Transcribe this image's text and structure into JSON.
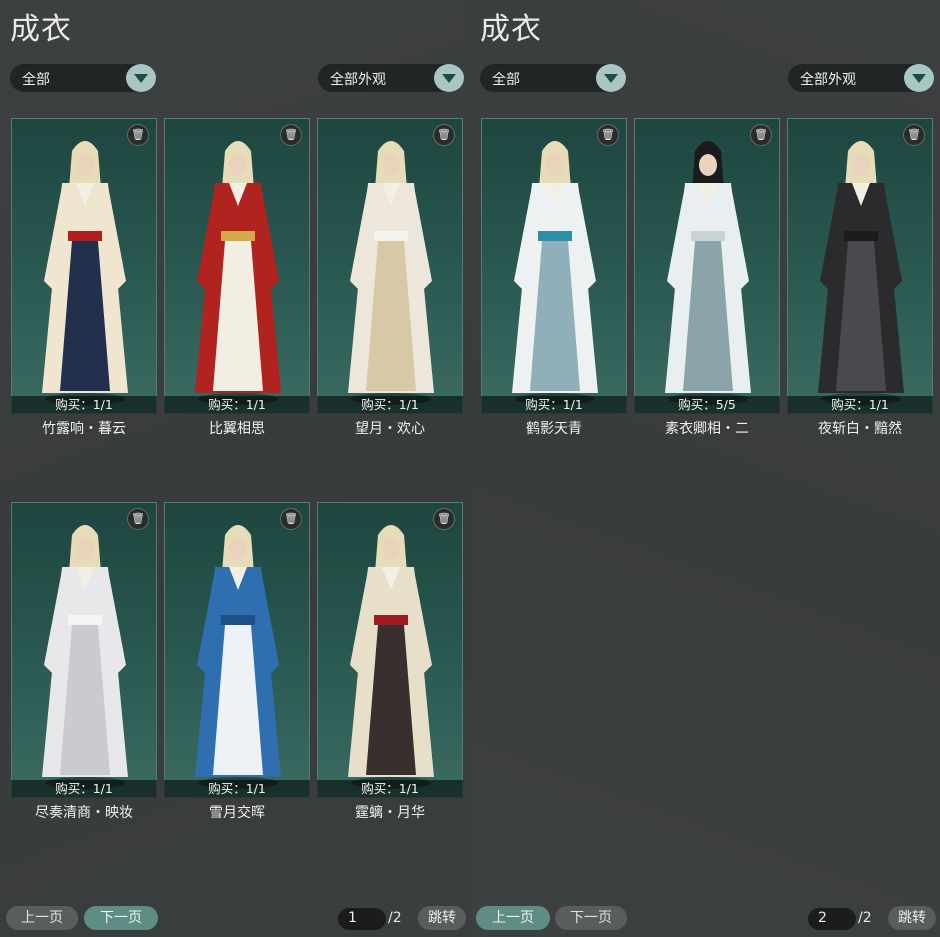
{
  "left": {
    "title": "成衣",
    "filter_category": "全部",
    "filter_appearance": "全部外观",
    "cards": [
      {
        "name": "竹露响・暮云",
        "buy": "购买：1/1",
        "colors": [
          "#f0e6cf",
          "#23304d",
          "#b21e1e"
        ]
      },
      {
        "name": "比翼相思",
        "buy": "购买：1/1",
        "colors": [
          "#b0231f",
          "#f3eee4",
          "#d4a84a"
        ]
      },
      {
        "name": "望月・欢心",
        "buy": "购买：1/1",
        "colors": [
          "#ece7da",
          "#d7c9a6",
          "#f5f3ee"
        ]
      },
      {
        "name": "尽奏清商・映妆",
        "buy": "购买：1/1",
        "colors": [
          "#e8e8ea",
          "#c9cbd0",
          "#f5f5f5"
        ]
      },
      {
        "name": "雪月交晖",
        "buy": "购买：1/1",
        "colors": [
          "#2f6fb0",
          "#eef2f6",
          "#1e4f86"
        ]
      },
      {
        "name": "霆螭・月华",
        "buy": "购买：1/1",
        "colors": [
          "#e7dfc9",
          "#3a2f2f",
          "#a01c22"
        ]
      }
    ],
    "prev_label": "上一页",
    "next_label": "下一页",
    "page_current": "1",
    "page_total": "/2",
    "jump_label": "跳转"
  },
  "right": {
    "title": "成衣",
    "filter_category": "全部",
    "filter_appearance": "全部外观",
    "cards": [
      {
        "name": "鹤影天青",
        "buy": "购买：1/1",
        "colors": [
          "#eef1f2",
          "#8fb0b8",
          "#2c8fa3"
        ]
      },
      {
        "name": "素衣卿相・二",
        "buy": "购买：5/5",
        "colors": [
          "#e9eef0",
          "#8aa4aa",
          "#c8d3d6"
        ]
      },
      {
        "name": "夜斩白・黯然",
        "buy": "购买：1/1",
        "colors": [
          "#2b2b2d",
          "#4a4a4e",
          "#1c1c1d"
        ]
      }
    ],
    "prev_label": "上一页",
    "next_label": "下一页",
    "page_current": "2",
    "page_total": "/2",
    "jump_label": "跳转"
  },
  "icons": {
    "trash": "trash-icon",
    "dropdown": "chevron-down-icon"
  }
}
